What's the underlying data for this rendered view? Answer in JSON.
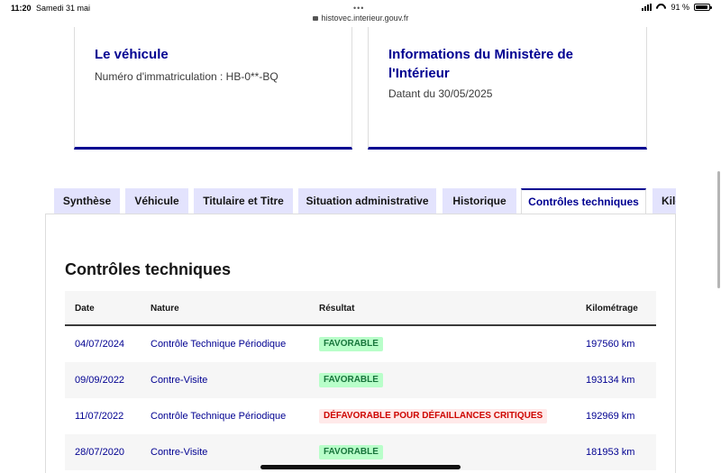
{
  "status_bar": {
    "time": "11:20",
    "date": "Samedi 31 mai",
    "url": "histovec.interieur.gouv.fr",
    "battery": "91 %",
    "battery_level": 0.91
  },
  "cards": {
    "vehicule": {
      "title": "Le véhicule",
      "text": "Numéro d'immatriculation : HB-0**-BQ"
    },
    "ministere": {
      "title": "Informations du Ministère de l'Intérieur",
      "text": "Datant du 30/05/2025"
    }
  },
  "tabs": [
    {
      "label": "Synthèse",
      "active": false
    },
    {
      "label": "Véhicule",
      "active": false
    },
    {
      "label": "Titulaire et Titre",
      "active": false
    },
    {
      "label": "Situation administrative",
      "active": false
    },
    {
      "label": "Historique",
      "active": false
    },
    {
      "label": "Contrôles techniques",
      "active": true
    },
    {
      "label": "Kilométrage",
      "active": false
    }
  ],
  "section": {
    "title": "Contrôles techniques"
  },
  "table": {
    "headers": {
      "date": "Date",
      "nature": "Nature",
      "result": "Résultat",
      "km": "Kilométrage"
    },
    "rows": [
      {
        "date": "04/07/2024",
        "nature": "Contrôle Technique Périodique",
        "result": "Favorable",
        "status": "ok",
        "km": "197560 km"
      },
      {
        "date": "09/09/2022",
        "nature": "Contre-Visite",
        "result": "Favorable",
        "status": "ok",
        "km": "193134 km"
      },
      {
        "date": "11/07/2022",
        "nature": "Contrôle Technique Périodique",
        "result": "Défavorable pour défaillances critiques",
        "status": "ko",
        "km": "192969 km"
      },
      {
        "date": "28/07/2020",
        "nature": "Contre-Visite",
        "result": "Favorable",
        "status": "ok",
        "km": "181953 km"
      }
    ]
  },
  "colors": {
    "brand_blue": "#000091",
    "tab_bg": "#e3e3fd",
    "success_bg": "#b8fec9",
    "success_text": "#18753c",
    "error_bg": "#ffe9e9",
    "error_text": "#ce0500"
  }
}
